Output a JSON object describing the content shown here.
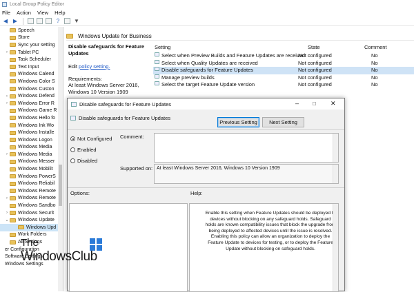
{
  "window": {
    "title": "Local Group Policy Editor"
  },
  "menu": [
    "File",
    "Action",
    "View",
    "Help"
  ],
  "tree": {
    "items": [
      {
        "label": "Speech",
        "exp": ""
      },
      {
        "label": "Store",
        "exp": ""
      },
      {
        "label": "Sync your setting",
        "exp": ""
      },
      {
        "label": "Tablet PC",
        "exp": ">"
      },
      {
        "label": "Task Scheduler",
        "exp": ""
      },
      {
        "label": "Text Input",
        "exp": ""
      },
      {
        "label": "Windows Calend",
        "exp": ""
      },
      {
        "label": "Windows Color S",
        "exp": ""
      },
      {
        "label": "Windows Custon",
        "exp": ""
      },
      {
        "label": "Windows Defend",
        "exp": ">"
      },
      {
        "label": "Windows Error R",
        "exp": ">"
      },
      {
        "label": "Windows Game R",
        "exp": ""
      },
      {
        "label": "Windows Hello fo",
        "exp": ""
      },
      {
        "label": "Windows Ink Wo",
        "exp": ""
      },
      {
        "label": "Windows Installe",
        "exp": ""
      },
      {
        "label": "Windows Logon",
        "exp": ""
      },
      {
        "label": "Windows Media",
        "exp": ""
      },
      {
        "label": "Windows Media",
        "exp": ">"
      },
      {
        "label": "Windows Messer",
        "exp": ""
      },
      {
        "label": "Windows Mobilit",
        "exp": ""
      },
      {
        "label": "Windows PowerS",
        "exp": ""
      },
      {
        "label": "Windows Reliabil",
        "exp": ""
      },
      {
        "label": "Windows Remote",
        "exp": ""
      },
      {
        "label": "Windows Remote",
        "exp": ">"
      },
      {
        "label": "Windows Sandbo",
        "exp": ""
      },
      {
        "label": "Windows Securit",
        "exp": ">"
      },
      {
        "label": "Windows Update",
        "exp": "v"
      },
      {
        "label": "Windows Upd",
        "exp": "",
        "selected": true,
        "indent": true
      },
      {
        "label": "Work Folders",
        "exp": ""
      },
      {
        "label": "All Settings",
        "exp": ""
      },
      {
        "label": "er Configuration",
        "exp": "",
        "root": true
      },
      {
        "label": "Software Settings",
        "exp": "",
        "root": true
      },
      {
        "label": "Windows Settings",
        "exp": "",
        "root": true
      }
    ]
  },
  "folder_header": "Windows Update for Business",
  "description": {
    "heading": "Disable safeguards for Feature Updates",
    "edit_prefix": "Edit",
    "edit_link": "policy setting.",
    "req_label": "Requirements:",
    "req_text": "At least Windows Server 2016, Windows 10 Version 1909"
  },
  "list": {
    "col_setting": "Setting",
    "col_state": "State",
    "col_comment": "Comment",
    "rows": [
      {
        "setting": "Select when Preview Builds and Feature Updates are received",
        "state": "Not configured",
        "comment": "No"
      },
      {
        "setting": "Select when Quality Updates are received",
        "state": "Not configured",
        "comment": "No"
      },
      {
        "setting": "Disable safeguards for Feature Updates",
        "state": "Not configured",
        "comment": "No",
        "selected": true
      },
      {
        "setting": "Manage preview builds",
        "state": "Not configured",
        "comment": "No"
      },
      {
        "setting": "Select the target Feature Update version",
        "state": "Not configured",
        "comment": "No"
      }
    ]
  },
  "dialog": {
    "title": "Disable safeguards for Feature Updates",
    "subtitle": "Disable safeguards for Feature Updates",
    "prev_button": "Previous Setting",
    "next_button": "Next Setting",
    "options": {
      "not_configured": "Not Configured",
      "enabled": "Enabled",
      "disabled": "Disabled"
    },
    "comment_label": "Comment:",
    "supported_label": "Supported on:",
    "supported_value": "At least Windows Server 2016, Windows 10 Version 1909",
    "options_label": "Options:",
    "help_label": "Help:",
    "help_text": "Enable this setting when Feature Updates should be deployed to devices without blocking on any safeguard holds. Safeguard holds are known compatibility issues that block the upgrade from being deployed to affected devices until the issue is resolved. Enabling this policy can allow an organization to deploy the Feature Update to devices for testing, or to deploy the Feature Update without blocking on safeguard holds."
  },
  "watermark": {
    "line1": "The",
    "line2": "WindowsClub"
  },
  "colors": {
    "selection": "#cce4f7",
    "folder": "#e8c25a",
    "link": "#1a55c5",
    "accent": "#0078d7"
  }
}
